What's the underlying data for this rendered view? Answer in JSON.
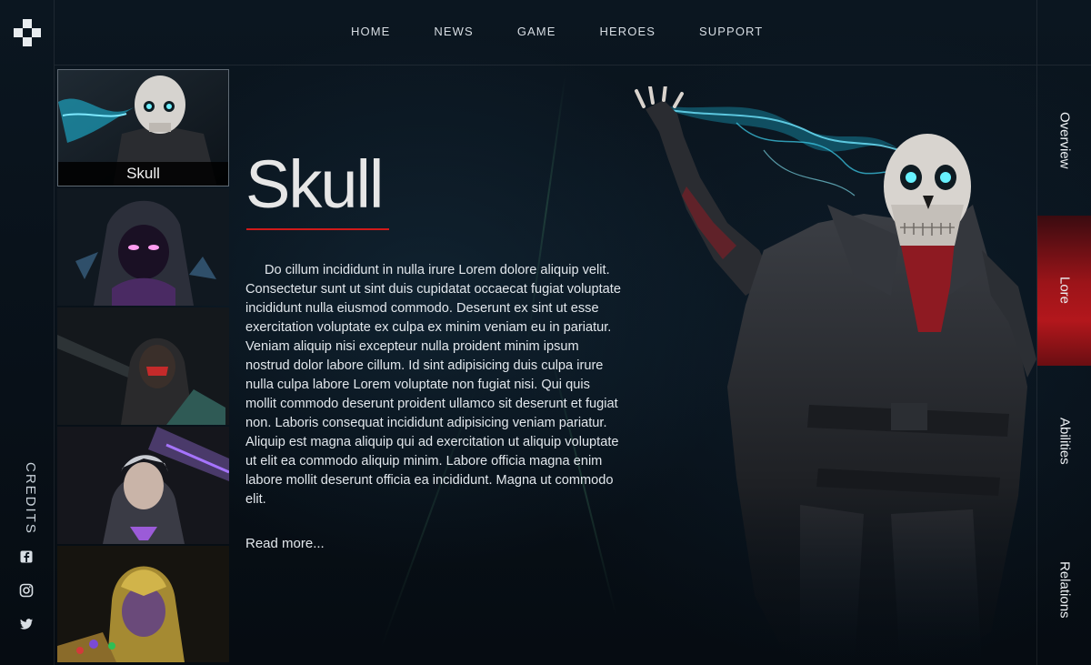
{
  "nav": {
    "items": [
      "HOME",
      "NEWS",
      "GAME",
      "HEROES",
      "SUPPORT"
    ]
  },
  "sidebar": {
    "credits_label": "CREDITS",
    "social": [
      "facebook-icon",
      "instagram-icon",
      "twitter-icon"
    ]
  },
  "heroes": {
    "items": [
      {
        "name": "Skull",
        "active": true
      },
      {
        "name": "",
        "active": false
      },
      {
        "name": "",
        "active": false
      },
      {
        "name": "",
        "active": false
      },
      {
        "name": "",
        "active": false
      }
    ]
  },
  "main": {
    "title": "Skull",
    "lore": "Do cillum incididunt in nulla irure Lorem dolore aliquip velit. Consectetur sunt ut sint duis cupidatat occaecat fugiat voluptate incididunt nulla eiusmod commodo. Deserunt ex sint ut esse exercitation voluptate ex culpa ex minim veniam eu in pariatur. Veniam aliquip nisi excepteur nulla proident minim ipsum nostrud dolor labore cillum. Id sint adipisicing duis culpa irure nulla culpa labore Lorem voluptate non fugiat nisi. Qui quis mollit commodo deserunt proident ullamco sit deserunt et fugiat non. Laboris consequat incididunt adipisicing veniam pariatur. Aliquip est magna aliquip qui ad exercitation ut aliquip voluptate ut elit ea commodo aliquip minim. Labore officia magna enim labore mollit deserunt officia ea incididunt. Magna ut commodo elit.",
    "read_more": "Read more..."
  },
  "tabs": {
    "items": [
      "Overview",
      "Lore",
      "Abilities",
      "Relations"
    ],
    "active": "Lore"
  },
  "colors": {
    "accent": "#d01a1a",
    "background": "#07111a"
  }
}
